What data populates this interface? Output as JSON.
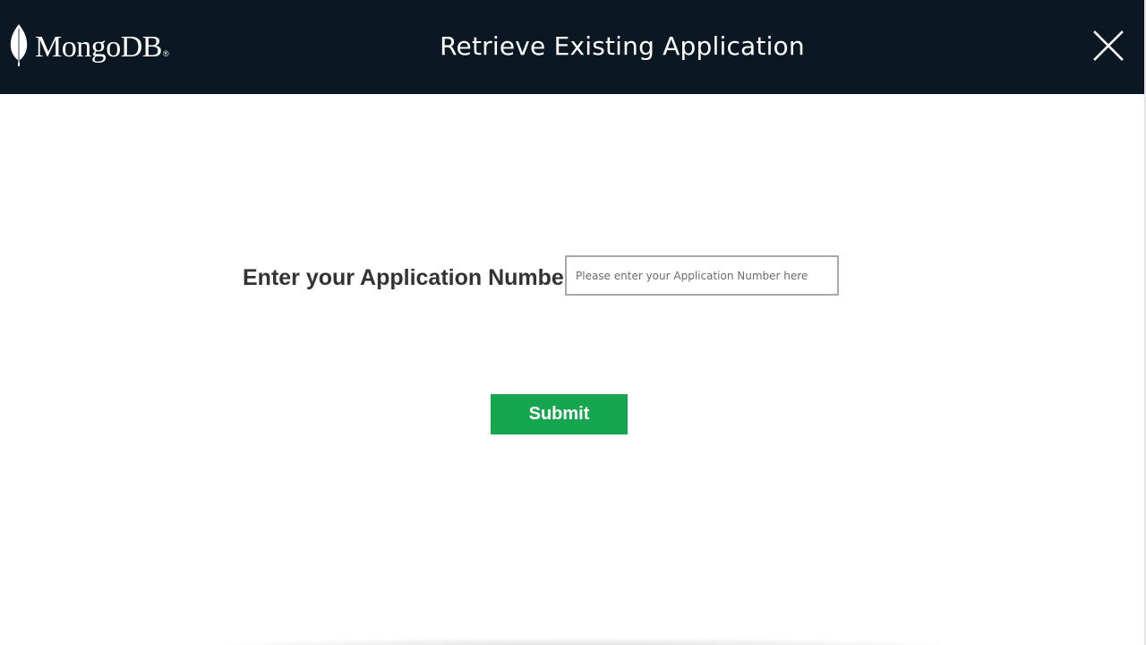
{
  "header": {
    "brand": "MongoDB",
    "brand_mark": "®",
    "title": "Retrieve Existing Application",
    "close_icon": "close-icon",
    "background_color": "#0b1823"
  },
  "form": {
    "label": "Enter your Application Number",
    "input_value": "",
    "input_placeholder": "Please enter your Application Number here",
    "submit_label": "Submit",
    "submit_color": "#17a650"
  }
}
